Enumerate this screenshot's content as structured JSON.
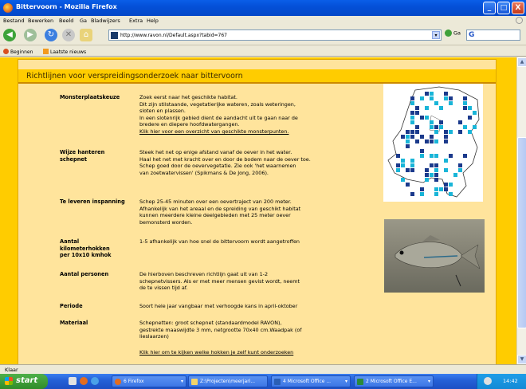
{
  "window": {
    "title": "Bittervoorn - Mozilla Firefox",
    "minimize": "_",
    "maximize": "□",
    "close": "X"
  },
  "menu": [
    "Bestand",
    "Bewerken",
    "Beeld",
    "Ga",
    "Bladwijzers",
    "Extra",
    "Help"
  ],
  "nav": {
    "url": "http://www.ravon.nl/Default.aspx?tabid=767",
    "go_label": "Ga",
    "search_letter": "G"
  },
  "bookmarks": [
    "Beginnen",
    "Laatste nieuws"
  ],
  "page": {
    "heading": "Richtlijnen voor verspreidingsonderzoek naar bittervoorn",
    "sections": [
      {
        "label": "Monsterplaatskeuze",
        "lines": [
          "Zoek eerst naar het geschikte habitat.",
          "Dit zijn stilstaande, vegetatierijke wateren, zoals weteringen,",
          "sloten en plassen.",
          "In een slotenrijk gebied dient de aandacht uit te gaan naar de",
          "bredere en diepere hoofdwatergangen."
        ],
        "link": "Klik hier voor een overzicht van geschikte monsterpunten."
      },
      {
        "label": "Wijze hanteren schepnet",
        "lines": [
          "Steek het net op enige afstand vanaf de oever in het water.",
          "Haal het net met kracht over en door de bodem naar de oever toe.",
          "Schep goed door de oevervegetatie. Zie ook 'het waarnemen",
          "van zoetwatervissen' (Spikmans & De Jong, 2006)."
        ]
      },
      {
        "label": "Te leveren inspanning",
        "lines": [
          "Schep 25-45 minuten over een oevertraject van 200 meter.",
          "Afhankelijk van het areaal en de spreiding van geschikt habitat",
          "kunnen meerdere kleine deelgebieden met 25 meter oever",
          "bemonsterd worden."
        ]
      },
      {
        "label": "Aantal kilometerhokken per 10x10 kmhok",
        "lines": [
          "1-5 afhankelijk van hoe snel de bittervoorn wordt aangetroffen"
        ]
      },
      {
        "label": "Aantal personen",
        "lines": [
          "De hierboven beschreven richtlijn gaat uit van 1-2",
          "schepnetvissers. Als er met meer mensen gevist wordt, neemt",
          "de te vissen tijd af."
        ]
      },
      {
        "label": "Periode",
        "lines": [
          "Soort hele jaar vangbaar met verhoogde kans in april-oktober"
        ]
      },
      {
        "label": "Materiaal",
        "lines": [
          "Schepnetten: groot schepnet (standaardmodel RAVON),",
          "gestrekte maaswijdte 3 mm, netgrootte 70x40 cm.Waadpak (of",
          "lieslaarzen)"
        ]
      }
    ],
    "bottom_link": "Klik hier om te kijken welke hokken je zelf kunt onderzoeken"
  },
  "status": "Klaar",
  "taskbar": {
    "start": "start",
    "tasks": [
      "6 Firefox",
      "Z:\\Projecten\\meerjari...",
      "4 Microsoft Office ...",
      "2 Microsoft Office E..."
    ],
    "clock": "14:42"
  },
  "colors": {
    "page_bg": "#FFCC00",
    "panel_bg": "#FFE49C",
    "map_blue": "#1B3A8C",
    "map_cyan": "#19B5D8"
  }
}
